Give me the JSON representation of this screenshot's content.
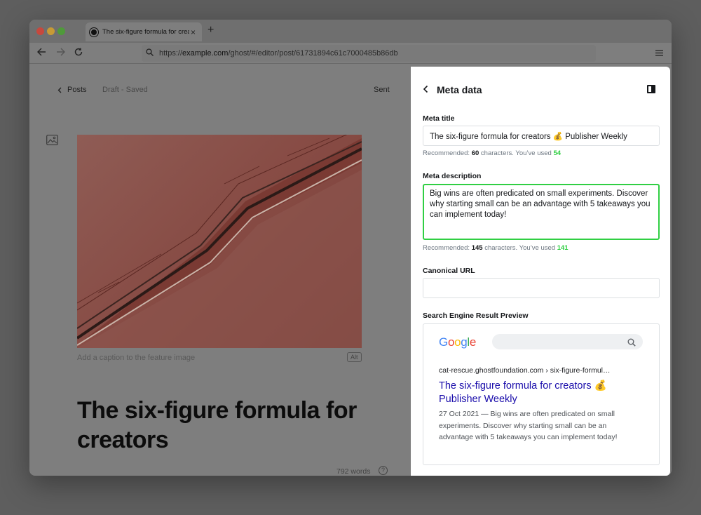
{
  "browser": {
    "tab_title": "The six-figure formula for creators",
    "tab_close": "×",
    "new_tab": "+",
    "url_prefix": "https://",
    "url_domain": "example.com",
    "url_path": "/ghost/#/editor/post/61731894c61c7000485b86db"
  },
  "editor": {
    "posts_label": "Posts",
    "status": "Draft - Saved",
    "sent_label": "Sent",
    "caption_placeholder": "Add a caption to the feature image",
    "alt_label": "Alt",
    "post_title": "The six-figure formula for creators",
    "word_count": "792 words",
    "help": "?"
  },
  "panel": {
    "back_glyph": "‹",
    "title": "Meta data",
    "meta_title_label": "Meta title",
    "meta_title_value": "The six-figure formula for creators 💰 Publisher Weekly",
    "meta_title_hint_prefix": "Recommended: ",
    "meta_title_recommended": "60",
    "meta_title_hint_mid": " characters. You’ve used ",
    "meta_title_used": "54",
    "meta_description_label": "Meta description",
    "meta_description_value": "Big wins are often predicated on small experiments. Discover why starting small can be an advantage with 5 takeaways you can implement today!",
    "meta_description_hint_prefix": "Recommended: ",
    "meta_description_recommended": "145",
    "meta_description_hint_mid": " characters. You’ve used ",
    "meta_description_used": "141",
    "canonical_url_label": "Canonical URL",
    "canonical_url_value": "",
    "serp_label": "Search Engine Result Preview"
  },
  "serp": {
    "google_letters": [
      "G",
      "o",
      "o",
      "g",
      "l",
      "e"
    ],
    "google_colors": [
      "#4285F4",
      "#EA4335",
      "#FBBC05",
      "#4285F4",
      "#34A853",
      "#EA4335"
    ],
    "url": "cat-rescue.ghostfoundation.com › six-figure-formul…",
    "title": "The six-figure formula for creators 💰 Publisher Weekly",
    "description": "27 Oct 2021 — Big wins are often predicated on small experiments. Discover why starting small can be an advantage with 5 takeaways you can implement today!"
  },
  "colors": {
    "accent_green": "#30cf43",
    "link_blue": "#1a0dab"
  }
}
